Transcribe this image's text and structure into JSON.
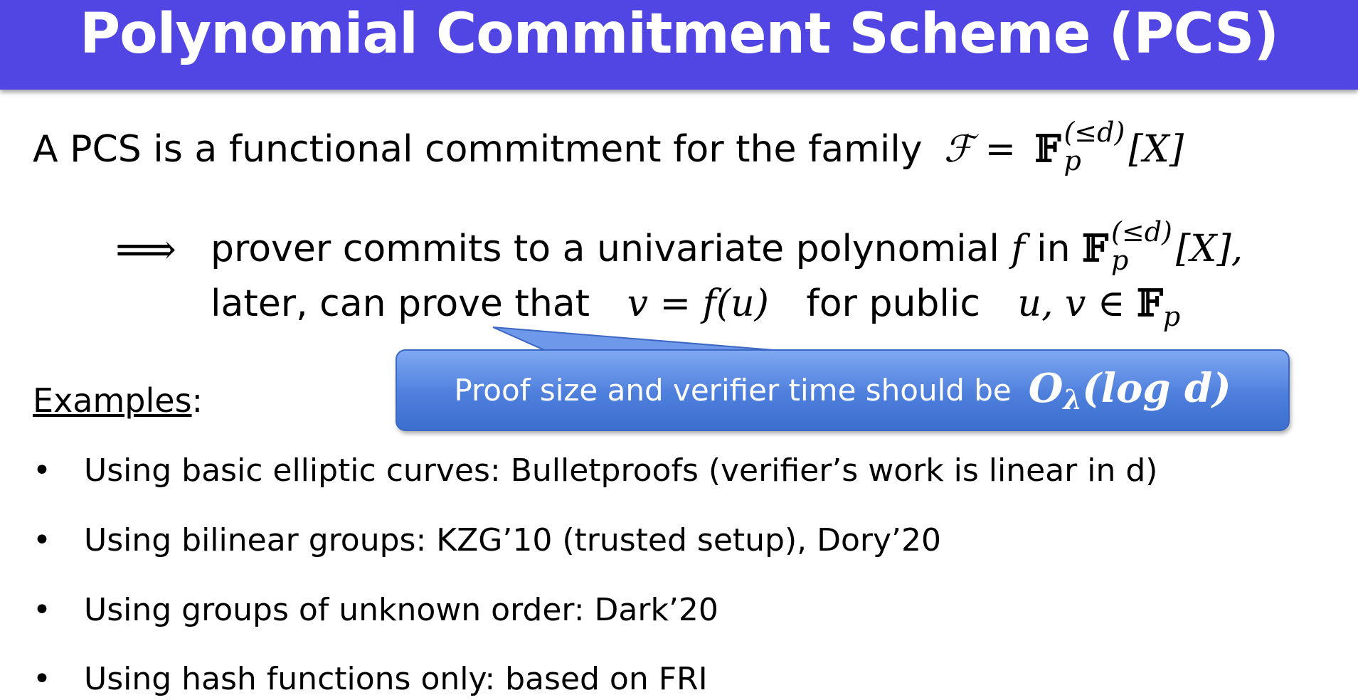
{
  "title": "Polynomial Commitment Scheme (PCS)",
  "definition": {
    "text": "A PCS is a functional commitment for the family",
    "math_lhs": "ℱ =",
    "math_field": "𝔽",
    "math_sup": "(≤d)",
    "math_sub": "p",
    "math_tail": "[X]"
  },
  "consequence": {
    "arrow": "⟹",
    "line1_text": "prover commits to a univariate polynomial",
    "line1_f": "f",
    "line1_in": "in",
    "line1_field": "𝔽",
    "line1_sup": "(≤d)",
    "line1_sub": "p",
    "line1_tail": "[X],",
    "line2_text": "later, can prove that",
    "line2_math": "v = f(u)",
    "line2_text2": "for public",
    "line2_math2": "u, v ∈",
    "line2_field": "𝔽",
    "line2_sub": "p"
  },
  "callout": {
    "text": "Proof size and verifier time should be",
    "math": "O",
    "math_sub": "λ",
    "math_tail": "(log d)",
    "color_top": "#7FA8F2",
    "color_bottom": "#3D6FCF"
  },
  "examples": {
    "label": "Examples",
    "colon": ":",
    "items": [
      {
        "bullet": "•",
        "text": "Using basic elliptic curves:   Bulletproofs (verifier’s work is linear in d)"
      },
      {
        "bullet": "•",
        "text": "Using bilinear groups:    KZG’10 (trusted setup),   Dory’20"
      },
      {
        "bullet": "•",
        "text": "Using groups of unknown order:   Dark’20"
      },
      {
        "bullet": "•",
        "text": "Using hash functions only:  based on FRI"
      }
    ]
  },
  "colors": {
    "title_bar": "#5146E3",
    "title_text": "#ffffff",
    "body_text": "#000000"
  }
}
